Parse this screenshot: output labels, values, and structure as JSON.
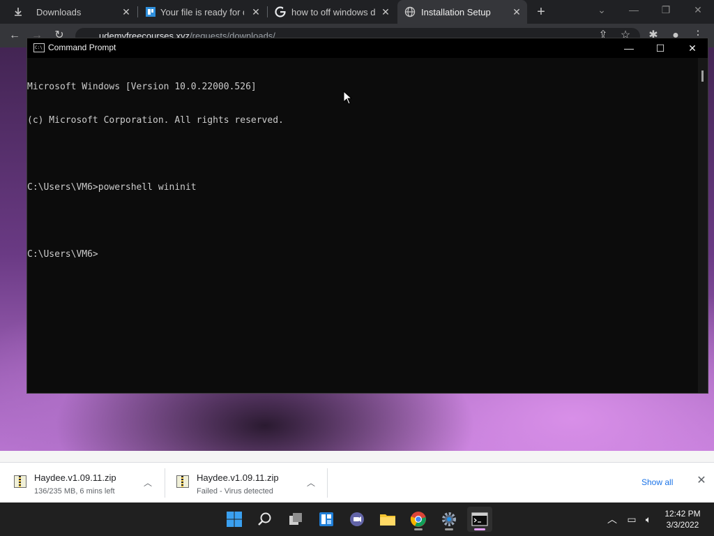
{
  "browser": {
    "tabs": [
      {
        "title": "Downloads",
        "icon": "download-icon",
        "active": false
      },
      {
        "title": "Your file is ready for download",
        "icon": "file-icon",
        "active": false
      },
      {
        "title": "how to off windows defender",
        "icon": "google-icon",
        "active": false
      },
      {
        "title": "Installation Setup",
        "icon": "globe-icon",
        "active": true
      }
    ],
    "new_tab": "+",
    "url_host": "udemyfreecourses.xyz",
    "url_path": "/requests/downloads/"
  },
  "cmd": {
    "title": "Command Prompt",
    "lines": [
      "Microsoft Windows [Version 10.0.22000.526]",
      "(c) Microsoft Corporation. All rights reserved.",
      "",
      "C:\\Users\\VM6>powershell wininit",
      "",
      "C:\\Users\\VM6>"
    ]
  },
  "downloads": {
    "items": [
      {
        "name": "Haydee.v1.09.11.zip",
        "status": "136/235 MB, 6 mins left",
        "progress": 0.58
      },
      {
        "name": "Haydee.v1.09.11.zip",
        "status": "Failed - Virus detected"
      }
    ],
    "show_all": "Show all"
  },
  "taskbar": {
    "apps": [
      "start-icon",
      "search-icon",
      "task-view-icon",
      "widgets-icon",
      "teams-chat-icon",
      "file-explorer-icon",
      "chrome-icon",
      "settings-icon",
      "command-prompt-icon"
    ],
    "active_app": "command-prompt-icon"
  },
  "clock": {
    "time": "12:42 PM",
    "date": "3/3/2022"
  },
  "colors": {
    "accent": "#1a73e8",
    "taskbar_active": "#e6a0ff"
  }
}
